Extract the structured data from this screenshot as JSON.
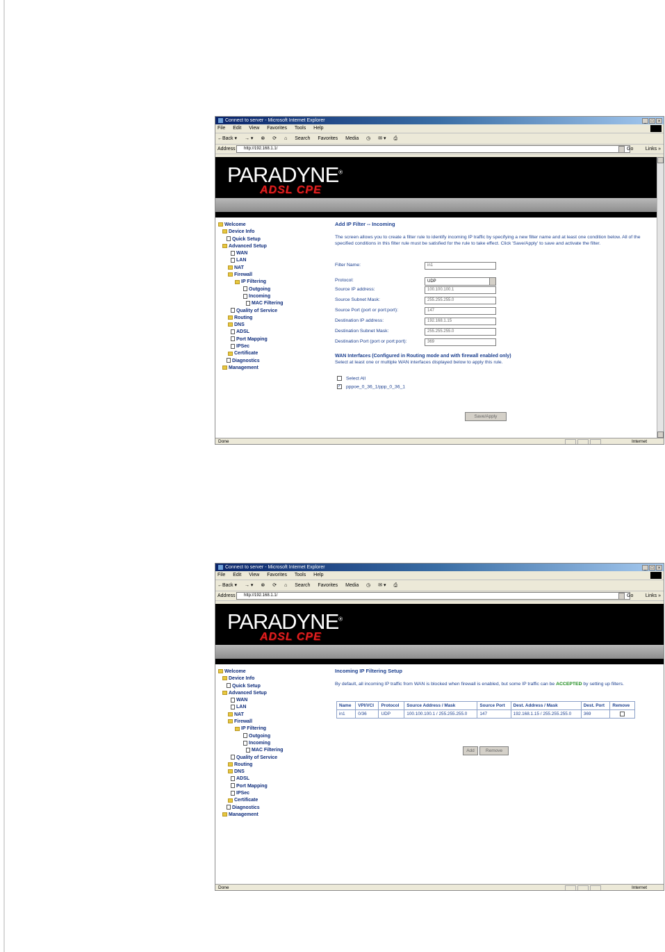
{
  "browser": {
    "title": "Connect to server - Microsoft Internet Explorer",
    "window_buttons": [
      "_",
      "□",
      "×"
    ],
    "menu": [
      "File",
      "Edit",
      "View",
      "Favorites",
      "Tools",
      "Help"
    ],
    "toolbar": [
      "←Back ▾",
      "→ ▾",
      "⊗",
      "⟳",
      "⌂",
      "Search",
      "Favorites",
      "Media",
      "◷",
      "✉ ▾",
      "⎙"
    ],
    "address_label": "Address",
    "url": "http://192.168.1.1/",
    "go_label": "Go",
    "links_label": "Links »",
    "status_text": "Done",
    "zone_text": "Internet"
  },
  "brand": {
    "logo": "PARADYNE",
    "reg": "®",
    "subtitle": "ADSL CPE"
  },
  "nav": {
    "items": [
      {
        "label": "Welcome"
      },
      {
        "label": "Device Info"
      },
      {
        "label": "Quick Setup"
      },
      {
        "label": "Advanced Setup"
      },
      {
        "label": "WAN"
      },
      {
        "label": "LAN"
      },
      {
        "label": "NAT"
      },
      {
        "label": "Firewall"
      },
      {
        "label": "IP Filtering"
      },
      {
        "label": "Outgoing"
      },
      {
        "label": "Incoming"
      },
      {
        "label": "MAC Filtering"
      },
      {
        "label": "Quality of Service"
      },
      {
        "label": "Routing"
      },
      {
        "label": "DNS"
      },
      {
        "label": "ADSL"
      },
      {
        "label": "Port Mapping"
      },
      {
        "label": "IPSec"
      },
      {
        "label": "Certificate"
      },
      {
        "label": "Diagnostics"
      },
      {
        "label": "Management"
      }
    ]
  },
  "add_filter": {
    "title": "Add IP Filter -- Incoming",
    "description": "The screen allows you to create a filter rule to identify incoming IP traffic by specifying a new filter name and at least one condition below. All of the specified conditions in this filter rule must be satisfied for the rule to take effect. Click 'Save/Apply' to save and activate the filter.",
    "fields": {
      "filter_name": {
        "label": "Filter Name:",
        "value": "in1"
      },
      "protocol": {
        "label": "Protocol:",
        "value": "UDP"
      },
      "src_ip": {
        "label": "Source IP address:",
        "value": "100.100.100.1"
      },
      "src_mask": {
        "label": "Source Subnet Mask:",
        "value": "255.255.255.0"
      },
      "src_port": {
        "label": "Source Port (port or port:port):",
        "value": "147"
      },
      "dst_ip": {
        "label": "Destination IP address:",
        "value": "192.168.1.15"
      },
      "dst_mask": {
        "label": "Destination Subnet Mask:",
        "value": "255.255.255.0"
      },
      "dst_port": {
        "label": "Destination Port (port or port:port):",
        "value": "369"
      }
    },
    "wan_title": "WAN Interfaces (Configured in Routing mode and with firewall enabled only)",
    "wan_desc": "Select at least one or multiple WAN interfaces displayed below to apply this rule.",
    "select_all": "Select All",
    "interface": "pppoe_0_36_1/ppp_0_36_1",
    "save_label": "Save/Apply"
  },
  "filter_setup": {
    "title": "Incoming IP Filtering Setup",
    "desc_pre": "By default, all incoming IP traffic from WAN is blocked when firewall is enabled, but some IP traffic can be",
    "desc_accepted": "ACCEPTED",
    "desc_post": "by setting up filters.",
    "headers": [
      "Name",
      "VPI/VCI",
      "Protocol",
      "Source Address / Mask",
      "Source Port",
      "Dest. Address / Mask",
      "Dest. Port",
      "Remove"
    ],
    "row": {
      "name": "in1",
      "vpivci": "0/36",
      "protocol": "UDP",
      "src": "100.100.100.1 / 255.255.255.0",
      "src_port": "147",
      "dst": "192.168.1.15 / 255.255.255.0",
      "dst_port": "369"
    },
    "add_label": "Add",
    "remove_label": "Remove"
  }
}
